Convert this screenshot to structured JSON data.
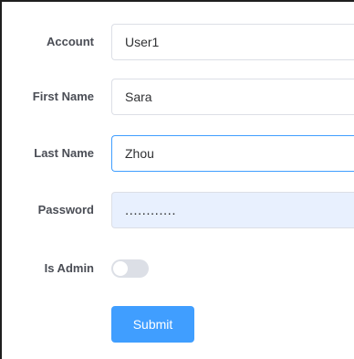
{
  "form": {
    "fields": [
      {
        "label": "Account",
        "value": "User1"
      },
      {
        "label": "First Name",
        "value": "Sara"
      },
      {
        "label": "Last Name",
        "value": "Zhou"
      },
      {
        "label": "Password",
        "value": "............"
      }
    ],
    "admin": {
      "label": "Is Admin",
      "checked": false
    },
    "submit_label": "Submit"
  },
  "colors": {
    "accent": "#409eff",
    "autofill_bg": "#e8f0fe",
    "border": "#dcdfe6",
    "toggle_off": "#dcdfe6"
  }
}
